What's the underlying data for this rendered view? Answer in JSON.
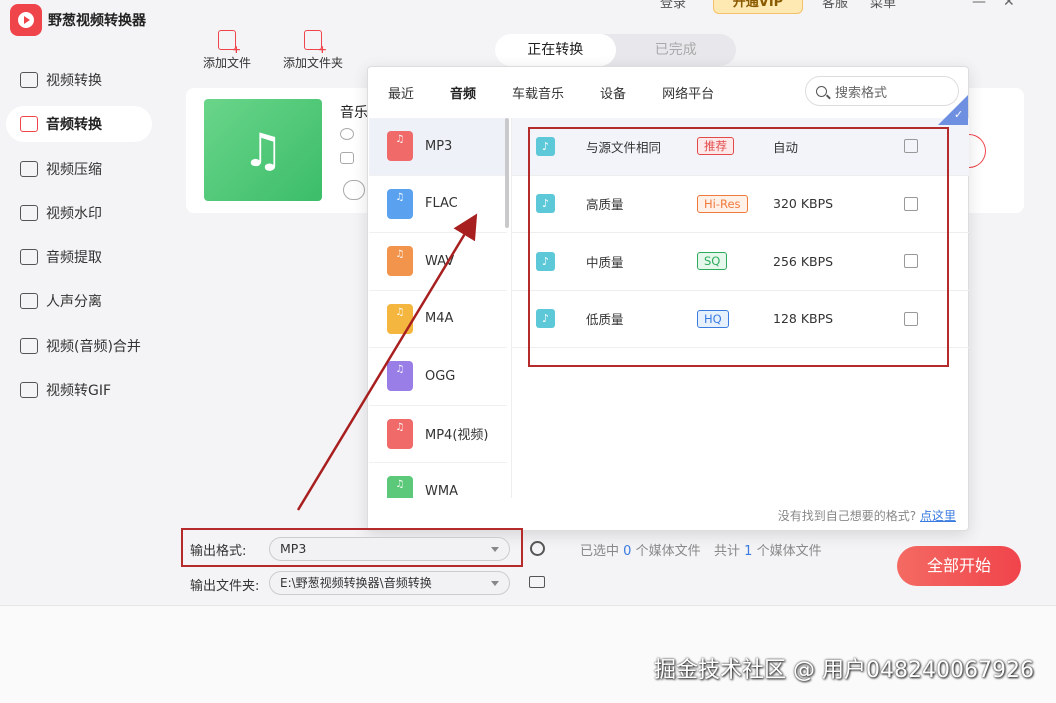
{
  "app": {
    "title": "野葱视频转换器"
  },
  "topbar": {
    "login": "登录",
    "vip": "开通VIP",
    "service": "客服",
    "menu": "菜单"
  },
  "sidebar": {
    "items": [
      {
        "label": "视频转换"
      },
      {
        "label": "音频转换"
      },
      {
        "label": "视频压缩"
      },
      {
        "label": "视频水印"
      },
      {
        "label": "音频提取"
      },
      {
        "label": "人声分离"
      },
      {
        "label": "视频(音频)合并"
      },
      {
        "label": "视频转GIF"
      }
    ],
    "active_index": 1
  },
  "toolbar": {
    "add_file": "添加文件",
    "add_folder": "添加文件夹"
  },
  "status_tabs": {
    "converting": "正在转换",
    "done": "已完成"
  },
  "card": {
    "title": "音乐"
  },
  "popup": {
    "tabs": [
      "最近",
      "音频",
      "车载音乐",
      "设备",
      "网络平台"
    ],
    "active_tab": "音频",
    "search_placeholder": "搜索格式",
    "formats": [
      {
        "name": "MP3",
        "color": "#f06a6a"
      },
      {
        "name": "FLAC",
        "color": "#5aa2ef"
      },
      {
        "name": "WAV",
        "color": "#f2944c"
      },
      {
        "name": "M4A",
        "color": "#f4b63f"
      },
      {
        "name": "OGG",
        "color": "#9a7ee8"
      },
      {
        "name": "MP4(视频)",
        "color": "#f06a6a"
      },
      {
        "name": "WMA",
        "color": "#5cc97a"
      }
    ],
    "qualities": [
      {
        "name": "与源文件相同",
        "tag": "推荐",
        "tag_color": "#e24a4a",
        "tag_bg": "#fde9e9",
        "bitrate": "自动"
      },
      {
        "name": "高质量",
        "tag": "Hi-Res",
        "tag_color": "#f07a3c",
        "tag_bg": "#fff1e8",
        "bitrate": "320 KBPS"
      },
      {
        "name": "中质量",
        "tag": "SQ",
        "tag_color": "#2eaa5c",
        "tag_bg": "#e6f7ec",
        "bitrate": "256 KBPS"
      },
      {
        "name": "低质量",
        "tag": "HQ",
        "tag_color": "#3a7be0",
        "tag_bg": "#e7f0fd",
        "bitrate": "128 KBPS"
      }
    ],
    "footer_text": "没有找到自己想要的格式?",
    "footer_link": "点这里"
  },
  "bottom": {
    "output_format_label": "输出格式:",
    "output_format_value": "MP3",
    "output_folder_label": "输出文件夹:",
    "output_folder_value": "E:\\野葱视频转换器\\音频转换",
    "selected_prefix": "已选中",
    "selected_count": "0",
    "selected_suffix": "个媒体文件",
    "total_prefix": "共计",
    "total_count": "1",
    "total_suffix": "个媒体文件",
    "start_all": "全部开始"
  },
  "watermark": "掘金技术社区 @ 用户048240067926"
}
